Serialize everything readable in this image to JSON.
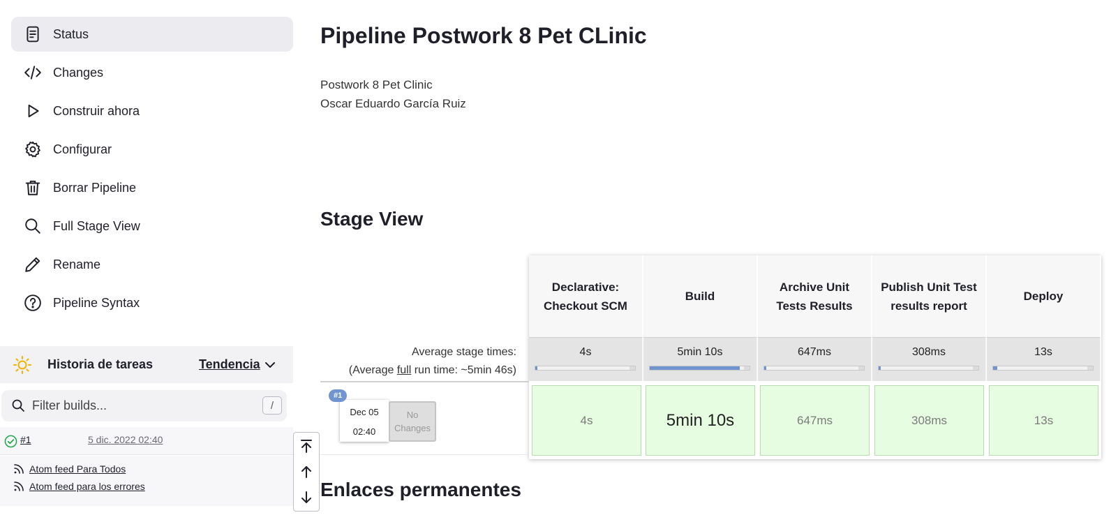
{
  "sidebar": {
    "items": [
      {
        "label": "Status",
        "icon": "document-icon"
      },
      {
        "label": "Changes",
        "icon": "code-icon"
      },
      {
        "label": "Construir ahora",
        "icon": "play-icon"
      },
      {
        "label": "Configurar",
        "icon": "gear-icon"
      },
      {
        "label": "Borrar Pipeline",
        "icon": "trash-icon"
      },
      {
        "label": "Full Stage View",
        "icon": "search-icon"
      },
      {
        "label": "Rename",
        "icon": "pencil-icon"
      },
      {
        "label": "Pipeline Syntax",
        "icon": "help-circle-icon"
      }
    ]
  },
  "history": {
    "title": "Historia de tareas",
    "trend_label": "Tendencia",
    "filter_placeholder": "Filter builds...",
    "shortcut_key": "/",
    "builds": [
      {
        "number": "#1",
        "date": "5 dic. 2022 02:40",
        "status": "success"
      }
    ],
    "feeds": {
      "all": "Atom feed Para Todos",
      "errors": "Atom feed para los errores"
    }
  },
  "main": {
    "title": "Pipeline Postwork 8 Pet CLinic",
    "description_line1": "Postwork 8 Pet Clinic",
    "description_line2": "Oscar Eduardo García Ruiz",
    "stage_view_title": "Stage View",
    "permalinks_title": "Enlaces permanentes"
  },
  "stage_view": {
    "avg_times_label": "Average stage times:",
    "avg_run_prefix": "(Average ",
    "avg_run_full": "full",
    "avg_run_suffix": " run time: ~5min 46s)",
    "stages": [
      {
        "name": "Declarative: Checkout SCM",
        "avg": "4s",
        "progress": 0.01,
        "time": "4s"
      },
      {
        "name": "Build",
        "avg": "5min 10s",
        "progress": 0.9,
        "time": "5min 10s"
      },
      {
        "name": "Archive Unit Tests Results",
        "avg": "647ms",
        "progress": 0.002,
        "time": "647ms"
      },
      {
        "name": "Publish Unit Test results report",
        "avg": "308ms",
        "progress": 0.001,
        "time": "308ms"
      },
      {
        "name": "Deploy",
        "avg": "13s",
        "progress": 0.04,
        "time": "13s"
      }
    ],
    "run": {
      "badge": "#1",
      "date": "Dec 05",
      "time": "02:40",
      "changes": "No Changes"
    },
    "colors": {
      "success_cell": "#e7fde2",
      "progress_fill": "#6f94d0"
    }
  }
}
